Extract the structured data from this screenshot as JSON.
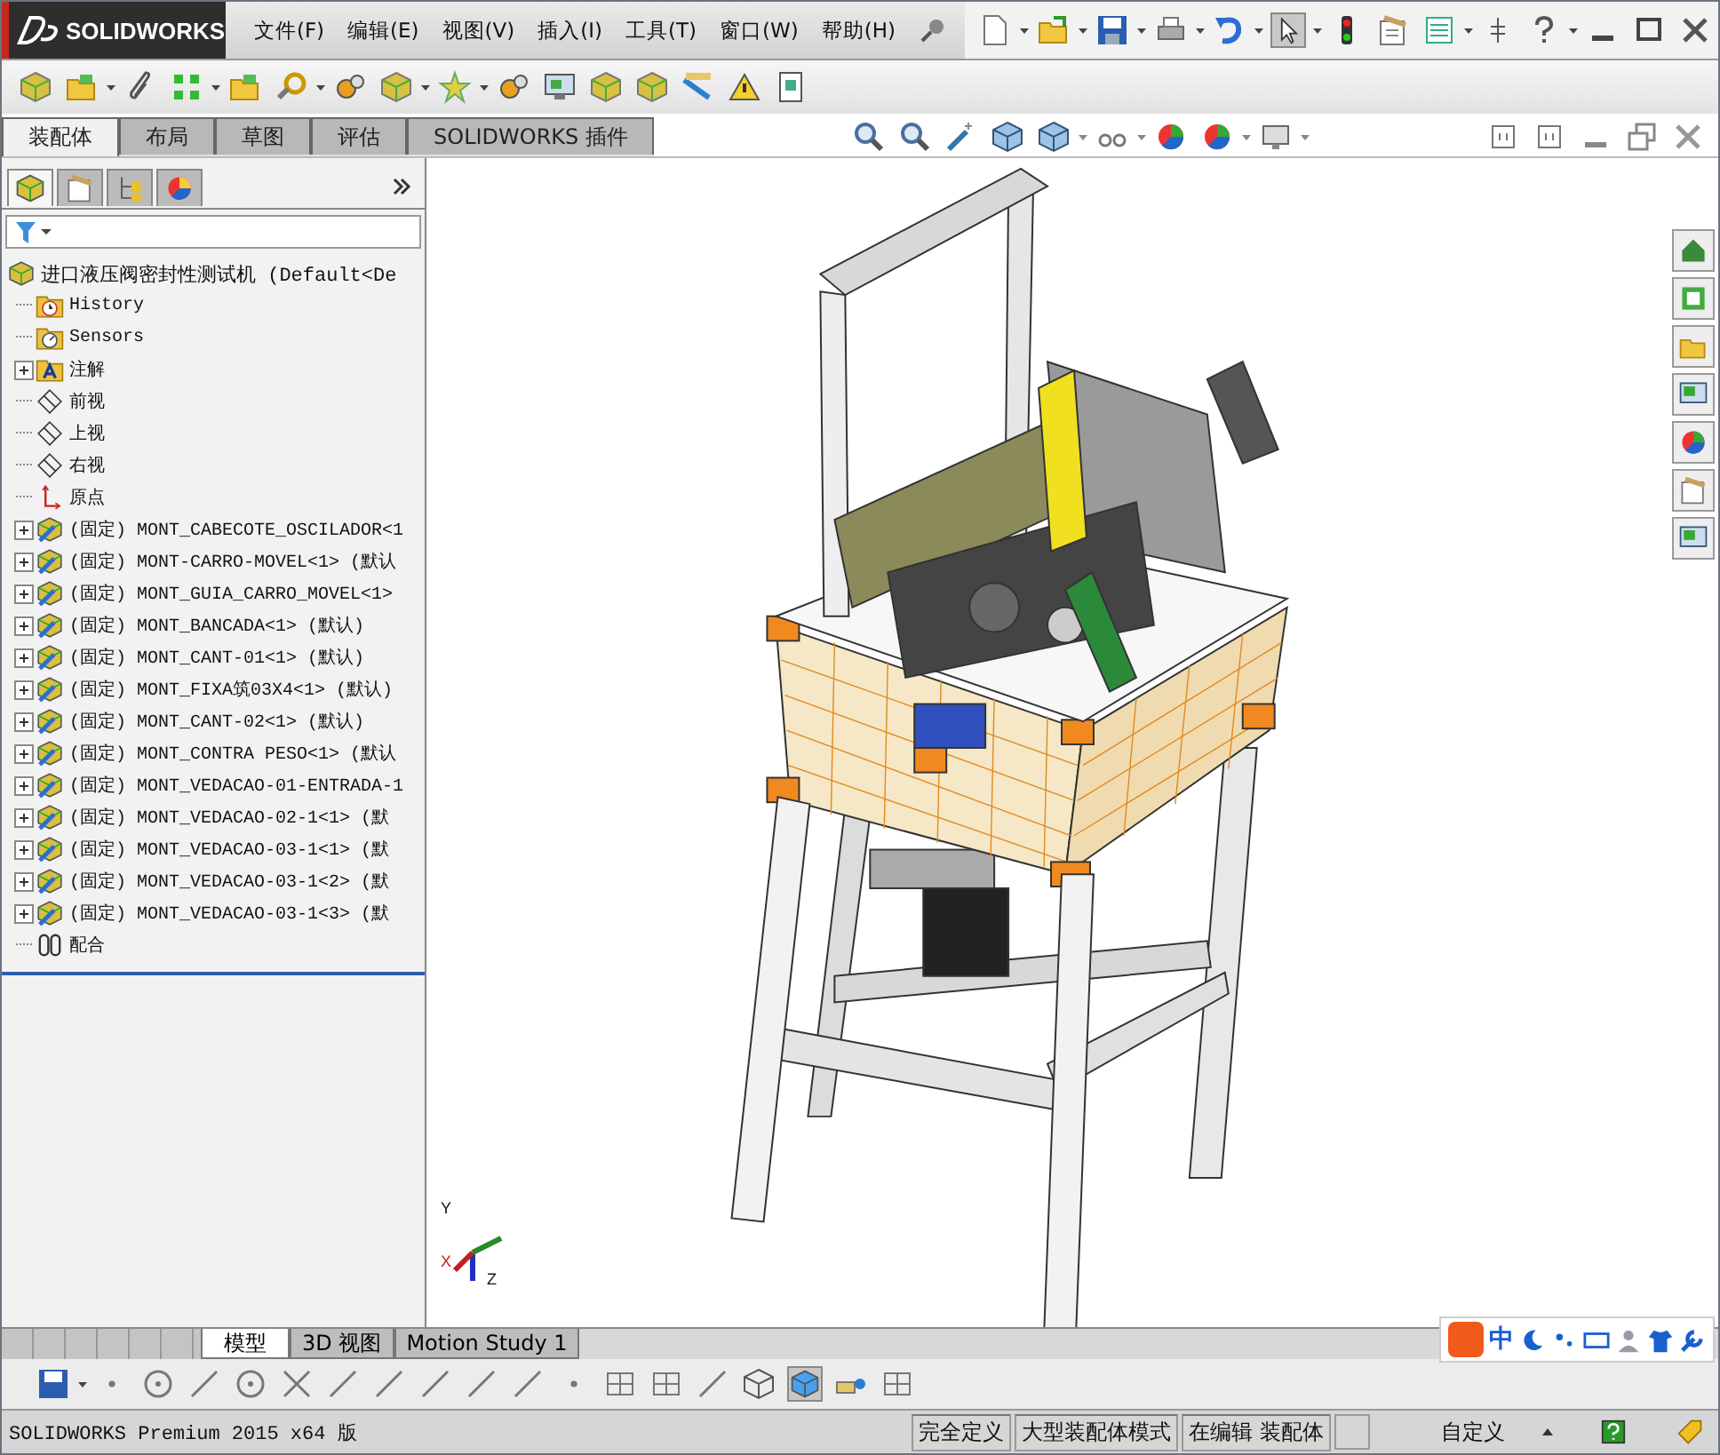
{
  "app": {
    "logo": "SOLIDWORKS"
  },
  "menu": [
    "文件(F)",
    "编辑(E)",
    "视图(V)",
    "插入(I)",
    "工具(T)",
    "窗口(W)",
    "帮助(H)"
  ],
  "command_tabs": [
    {
      "label": "装配体",
      "selected": true
    },
    {
      "label": "布局",
      "selected": false
    },
    {
      "label": "草图",
      "selected": false
    },
    {
      "label": "评估",
      "selected": false
    },
    {
      "label": "SOLIDWORKS 插件",
      "selected": false
    }
  ],
  "feature_tree": {
    "root": {
      "label": "进口液压阀密封性测试机 (Default<De",
      "children": [
        {
          "kind": "history",
          "label": "History"
        },
        {
          "kind": "sensors",
          "label": "Sensors"
        },
        {
          "kind": "annotations",
          "label": "注解",
          "expanded": false
        },
        {
          "kind": "plane",
          "label": "前视"
        },
        {
          "kind": "plane",
          "label": "上视"
        },
        {
          "kind": "plane",
          "label": "右视"
        },
        {
          "kind": "origin",
          "label": "原点"
        },
        {
          "kind": "component",
          "label": "(固定) MONT_CABECOTE_OSCILADOR<1",
          "expanded": false
        },
        {
          "kind": "component",
          "label": "(固定) MONT-CARRO-MOVEL<1> (默认",
          "expanded": false
        },
        {
          "kind": "component",
          "label": "(固定) MONT_GUIA_CARRO_MOVEL<1>",
          "expanded": false
        },
        {
          "kind": "component",
          "label": "(固定) MONT_BANCADA<1> (默认)",
          "expanded": false
        },
        {
          "kind": "component",
          "label": "(固定) MONT_CANT-01<1> (默认)",
          "expanded": false
        },
        {
          "kind": "component",
          "label": "(固定) MONT_FIXA筑03X4<1> (默认)",
          "expanded": false
        },
        {
          "kind": "component",
          "label": "(固定) MONT_CANT-02<1> (默认)",
          "expanded": false
        },
        {
          "kind": "component",
          "label": "(固定) MONT_CONTRA PESO<1> (默认",
          "expanded": false
        },
        {
          "kind": "component",
          "label": "(固定) MONT_VEDACAO-01-ENTRADA-1",
          "expanded": false
        },
        {
          "kind": "component",
          "label": "(固定) MONT_VEDACAO-02-1<1> (默",
          "expanded": false
        },
        {
          "kind": "component",
          "label": "(固定) MONT_VEDACAO-03-1<1> (默",
          "expanded": false
        },
        {
          "kind": "component",
          "label": "(固定) MONT_VEDACAO-03-1<2> (默",
          "expanded": false
        },
        {
          "kind": "component",
          "label": "(固定) MONT_VEDACAO-03-1<3> (默",
          "expanded": false
        },
        {
          "kind": "mates",
          "label": "配合"
        }
      ]
    }
  },
  "triad": {
    "x": "X",
    "y": "Y",
    "z": "Z"
  },
  "bottom_tabs": [
    {
      "label": "模型",
      "selected": true
    },
    {
      "label": "3D 视图",
      "selected": false
    },
    {
      "label": "Motion Study 1",
      "selected": false
    }
  ],
  "ime": {
    "label": "中"
  },
  "status_bar": {
    "product": "SOLIDWORKS Premium 2015 x64 版",
    "fields": [
      "完全定义",
      "大型装配体模式",
      "在编辑 装配体"
    ],
    "units": "自定义"
  }
}
